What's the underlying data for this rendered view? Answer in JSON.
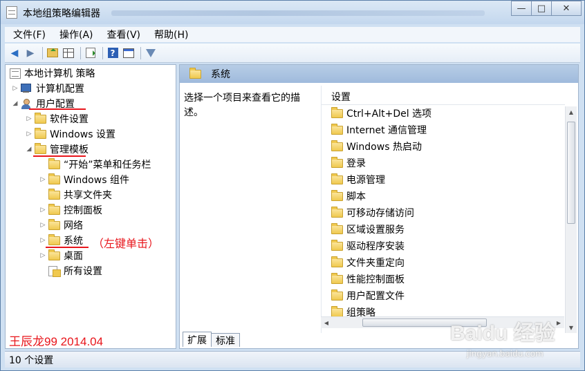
{
  "window": {
    "title": "本地组策略编辑器",
    "controls": {
      "minimize": "—",
      "maximize": "□",
      "close": "✕"
    }
  },
  "menubar": [
    "文件(F)",
    "操作(A)",
    "查看(V)",
    "帮助(H)"
  ],
  "toolbar_icons": [
    "back-icon",
    "forward-icon",
    "up-folder-icon",
    "show-tree-icon",
    "export-list-icon",
    "help-icon",
    "properties-icon",
    "filter-icon"
  ],
  "tree": {
    "root": "本地计算机 策略",
    "computer_config": "计算机配置",
    "user_config": "用户配置",
    "software_settings": "软件设置",
    "windows_settings": "Windows 设置",
    "admin_templates": "管理模板",
    "start_menu": "“开始”菜单和任务栏",
    "windows_components": "Windows 组件",
    "shared_folders": "共享文件夹",
    "control_panel": "控制面板",
    "network": "网络",
    "system": "系统",
    "desktop": "桌面",
    "all_settings": "所有设置"
  },
  "annotation": {
    "note": "（左键单击）",
    "author": "王辰龙99 2014.04",
    "color": "#e8151b"
  },
  "right": {
    "header": "系统",
    "description": "选择一个项目来查看它的描述。",
    "column_header": "设置",
    "items": [
      "Ctrl+Alt+Del 选项",
      "Internet 通信管理",
      "Windows 热启动",
      "登录",
      "电源管理",
      "脚本",
      "可移动存储访问",
      "区域设置服务",
      "驱动程序安装",
      "文件夹重定向",
      "性能控制面板",
      "用户配置文件",
      "组策略"
    ],
    "tabs": [
      "扩展",
      "标准"
    ]
  },
  "status": "10 个设置",
  "watermark": {
    "main": "Baidu 经验",
    "sub": "jingyan.baidu.com"
  }
}
